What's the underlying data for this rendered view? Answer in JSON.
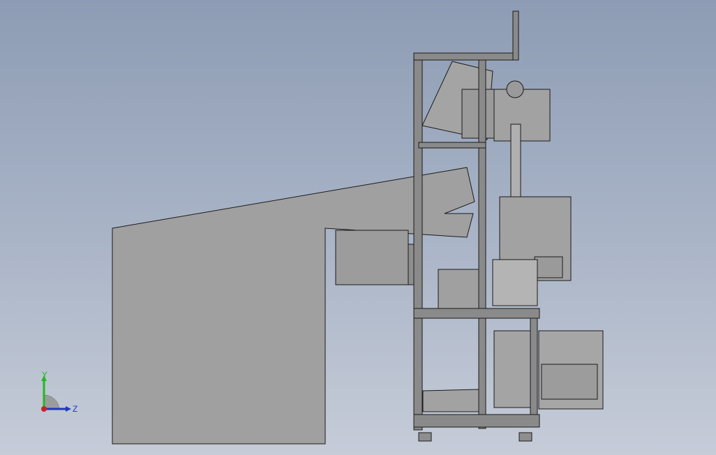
{
  "viewport": {
    "background_top": "#8d9cb4",
    "background_bottom": "#c6ccd8"
  },
  "model": {
    "part_fill": "#9e9e9e",
    "panel_fill": "#a8a8a8",
    "frame_fill": "#8a8a8a",
    "edge_color": "#1a1a1a"
  },
  "triad": {
    "y_label": "Y",
    "z_label": "Z",
    "y_color": "#22b822",
    "z_color": "#2233cc",
    "origin_color": "#cc2222"
  }
}
